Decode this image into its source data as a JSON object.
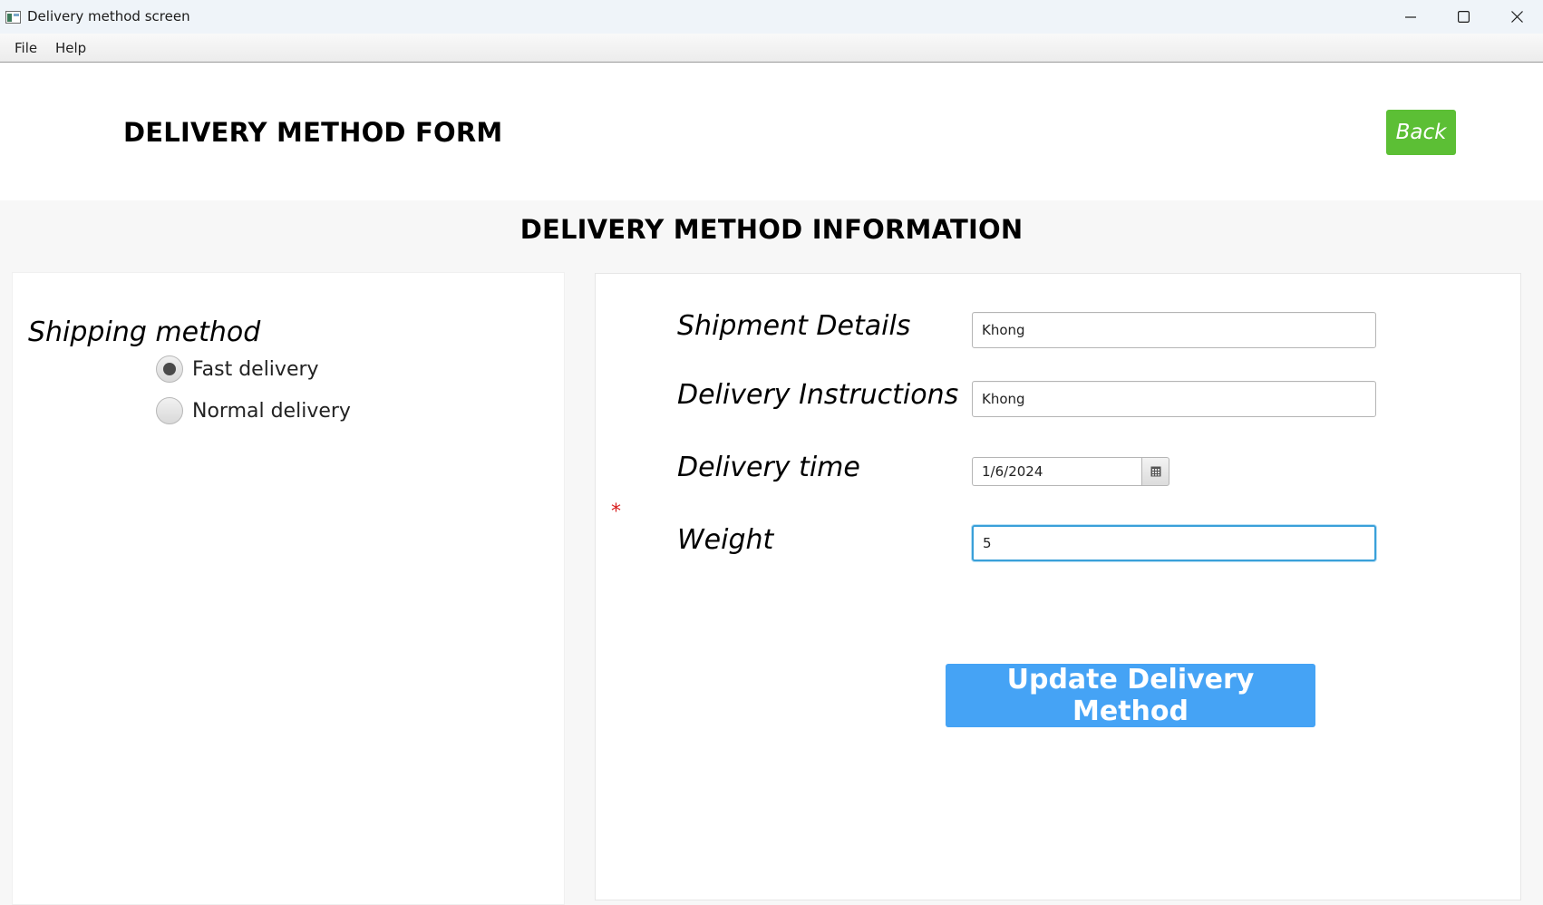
{
  "window": {
    "title": "Delivery method screen"
  },
  "menu": {
    "items": [
      "File",
      "Help"
    ]
  },
  "header": {
    "title": "DELIVERY METHOD FORM",
    "back_label": "Back"
  },
  "content": {
    "section_title": "DELIVERY METHOD INFORMATION",
    "shipping": {
      "label": "Shipping method",
      "options": [
        {
          "label": "Fast delivery",
          "selected": true
        },
        {
          "label": "Normal delivery",
          "selected": false
        }
      ]
    },
    "fields": {
      "shipment_details": {
        "label": "Shipment Details",
        "value": "Khong"
      },
      "delivery_instructions": {
        "label": "Delivery Instructions",
        "value": "Khong"
      },
      "delivery_time": {
        "label": "Delivery time",
        "value": "1/6/2024"
      },
      "weight": {
        "label": "Weight",
        "value": "5",
        "required_marker": "*"
      }
    },
    "update_label": "Update Delivery Method"
  },
  "colors": {
    "back_button": "#5cbf35",
    "update_button": "#45a3f5",
    "focus_ring": "#3aa0d9",
    "required": "#d81e1e"
  },
  "icons": {
    "app": "window-app-icon",
    "minimize": "minimize-icon",
    "maximize": "maximize-icon",
    "close": "close-icon",
    "calendar": "calendar-icon"
  }
}
